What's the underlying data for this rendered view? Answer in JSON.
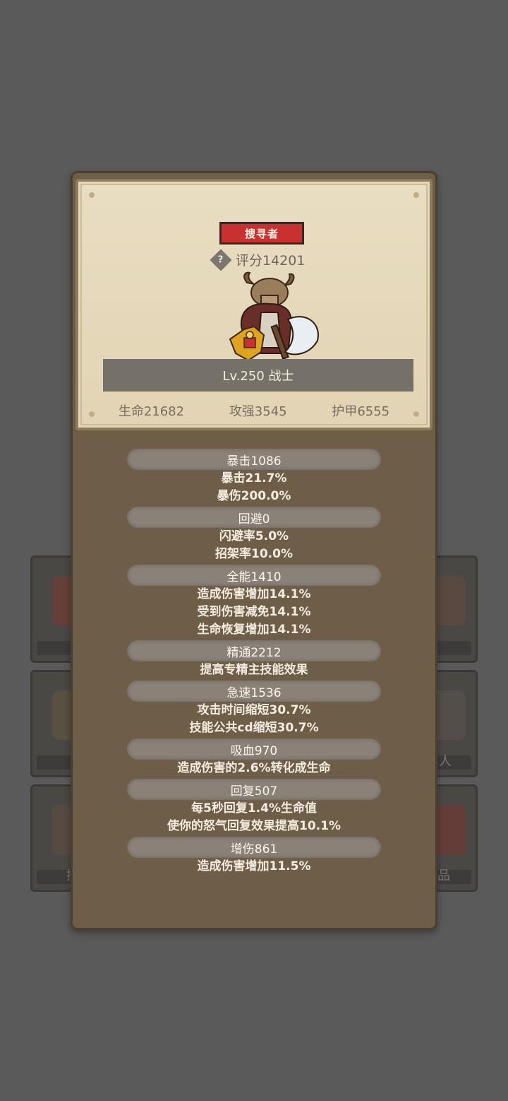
{
  "card": {
    "rank_tag": "搜寻者",
    "score": "评分14201",
    "level_class": "Lv.250 战士",
    "stats": [
      "生命21682",
      "攻强3545",
      "护甲6555"
    ]
  },
  "attributes": [
    {
      "head": "暴击1086",
      "lines": [
        "暴击21.7%",
        "暴伤200.0%"
      ]
    },
    {
      "head": "回避0",
      "lines": [
        "闪避率5.0%",
        "招架率10.0%"
      ]
    },
    {
      "head": "全能1410",
      "lines": [
        "造成伤害增加14.1%",
        "受到伤害减免14.1%",
        "生命恢复增加14.1%"
      ]
    },
    {
      "head": "精通2212",
      "lines": [
        "提高专精主技能效果"
      ]
    },
    {
      "head": "急速1536",
      "lines": [
        "攻击时间缩短30.7%",
        "技能公共cd缩短30.7%"
      ]
    },
    {
      "head": "吸血970",
      "lines": [
        "造成伤害的2.6%转化成生命"
      ]
    },
    {
      "head": "回复507",
      "lines": [
        "每5秒回复1.4%生命值",
        "使你的怒气回复效果提高10.1%"
      ]
    },
    {
      "head": "增伤861",
      "lines": [
        "造成伤害增加11.5%"
      ]
    }
  ],
  "background": {
    "labels": [
      "人",
      "提",
      "品"
    ]
  },
  "colors": {
    "tag_red": "#c8312f",
    "panel_brown": "#6e5e48",
    "card_parchment": "#e4d7b9"
  }
}
